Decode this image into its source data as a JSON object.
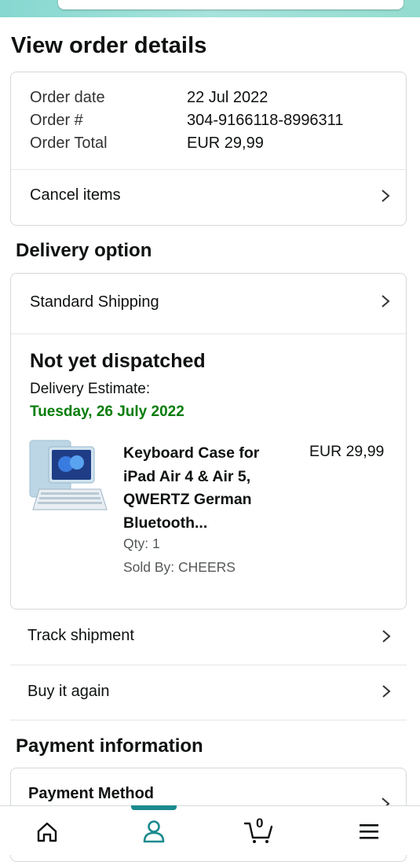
{
  "page": {
    "title": "View order details"
  },
  "summary": {
    "rows": [
      {
        "label": "Order date",
        "value": "22 Jul 2022"
      },
      {
        "label": "Order #",
        "value": "304-9166118-8996311"
      },
      {
        "label": "Order Total",
        "value": "EUR 29,99"
      }
    ],
    "cancel_label": "Cancel items"
  },
  "delivery": {
    "section_title": "Delivery option",
    "shipping_label": "Standard Shipping",
    "status": "Not yet dispatched",
    "estimate_label": "Delivery Estimate:",
    "estimate_date": "Tuesday, 26 July 2022",
    "estimate_color": "#067d0a",
    "product": {
      "title_lines": [
        "Keyboard Case for",
        "iPad Air 4 & Air 5,",
        "QWERTZ German",
        "Bluetooth..."
      ],
      "price": "EUR 29,99",
      "qty": "Qty: 1",
      "seller": "Sold By: CHEERS"
    }
  },
  "actions": {
    "track_label": "Track shipment",
    "buy_again_label": "Buy it again"
  },
  "payment": {
    "section_title": "Payment information",
    "method_label": "Payment Method"
  },
  "bottom_nav": {
    "items": [
      "home-icon",
      "account-icon",
      "cart-icon",
      "menu-icon"
    ],
    "cart_count": "0",
    "active_color": "#1b8a8e"
  }
}
